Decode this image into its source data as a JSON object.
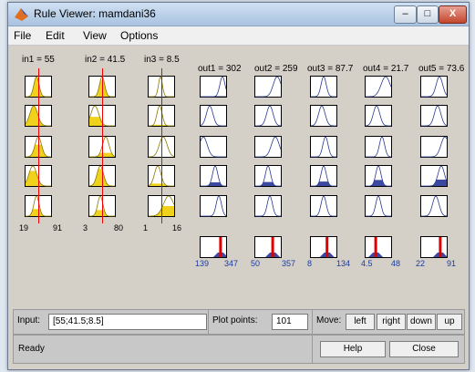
{
  "window": {
    "title": "Rule Viewer: mamdani36"
  },
  "titlebar_buttons": {
    "minimize": "–",
    "maximize": "□",
    "close": "X"
  },
  "menu": [
    "File",
    "Edit",
    "View",
    "Options"
  ],
  "inputs": [
    {
      "label": "in1 = 55",
      "range_min": "19",
      "range_max": "91",
      "value": 55
    },
    {
      "label": "in2 = 41.5",
      "range_min": "3",
      "range_max": "80",
      "value": 41.5
    },
    {
      "label": "in3 = 8.5",
      "range_min": "1",
      "range_max": "16",
      "value": 8.5
    }
  ],
  "outputs": [
    {
      "label": "out1 = 302",
      "range_min": "139",
      "range_max": "347",
      "value": 302
    },
    {
      "label": "out2 = 259",
      "range_min": "50",
      "range_max": "357",
      "value": 259
    },
    {
      "label": "out3 = 87.7",
      "range_min": "8",
      "range_max": "134",
      "value": 87.7
    },
    {
      "label": "out4 = 21.7",
      "range_min": "4.5",
      "range_max": "48",
      "value": 21.7
    },
    {
      "label": "out5 = 73.6",
      "range_min": "22",
      "range_max": "91",
      "value": 73.6
    }
  ],
  "rules": [
    "1",
    "2",
    "3",
    "4",
    "5"
  ],
  "bottom": {
    "input_label": "Input:",
    "input_value": "[55;41.5;8.5]",
    "plot_points_label": "Plot points:",
    "plot_points_value": "101",
    "move_label": "Move:",
    "move_buttons": [
      "left",
      "right",
      "down",
      "up"
    ],
    "status": "Ready",
    "help": "Help",
    "close": "Close"
  },
  "colors": {
    "fill_input": "#f0d21c",
    "fill_output": "#3b4aa0",
    "indicator": "#e00000"
  }
}
